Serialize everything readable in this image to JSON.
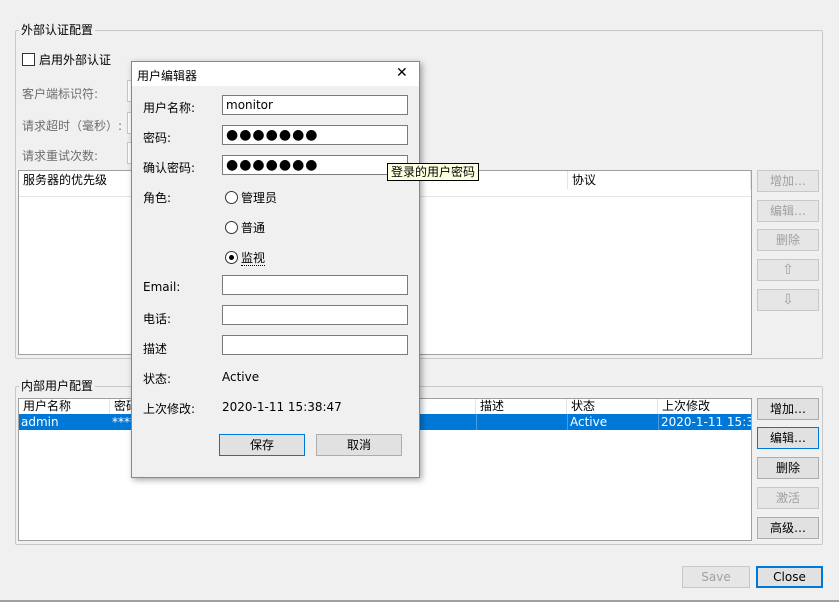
{
  "external": {
    "legend": "外部认证配置",
    "enable_label": "启用外部认证",
    "client_id_label": "客户端标识符:",
    "timeout_label": "请求超时（毫秒）:",
    "retry_label": "请求重试次数:",
    "columns": [
      "服务器的优先级",
      "协议"
    ],
    "buttons": {
      "add": "增加…",
      "edit": "编辑…",
      "delete": "删除",
      "up": "⇧",
      "down": "⇩"
    }
  },
  "internal": {
    "legend": "内部用户配置",
    "columns": [
      "用户名称",
      "密码",
      "描述",
      "状态",
      "上次修改"
    ],
    "rows": [
      {
        "username": "admin",
        "password": "****",
        "description": "",
        "status": "Active",
        "modified": "2020-1-11 15:3..."
      }
    ],
    "buttons": {
      "add": "增加…",
      "edit": "编辑…",
      "delete": "删除",
      "activate": "激活",
      "advanced": "高级…"
    }
  },
  "footer": {
    "save": "Save",
    "close": "Close"
  },
  "dialog": {
    "title": "用户编辑器",
    "close_glyph": "✕",
    "username_label": "用户名称:",
    "username_value": "monitor",
    "password_label": "密码:",
    "password_value": "●●●●●●●",
    "confirm_label": "确认密码:",
    "confirm_value": "●●●●●●●",
    "role_label": "角色:",
    "roles": [
      "管理员",
      "普通",
      "监视"
    ],
    "selected_role": "监视",
    "email_label": "Email:",
    "phone_label": "电话:",
    "desc_label": "描述",
    "status_label": "状态:",
    "status_value": "Active",
    "modified_label": "上次修改:",
    "modified_value": "2020-1-11 15:38:47",
    "save": "保存",
    "cancel": "取消"
  },
  "tooltip": "登录的用户密码"
}
